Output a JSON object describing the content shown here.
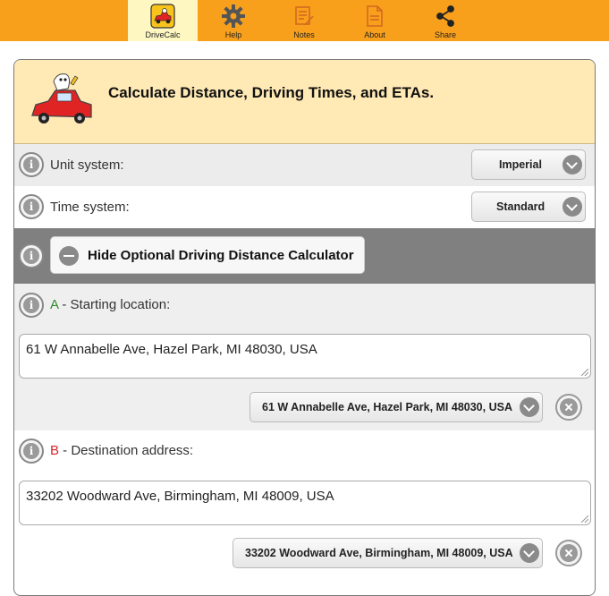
{
  "tabs": [
    {
      "label": "DriveCalc",
      "icon": "car-app-icon",
      "active": true
    },
    {
      "label": "Help",
      "icon": "gear-icon"
    },
    {
      "label": "Notes",
      "icon": "notepad-pencil-icon"
    },
    {
      "label": "About",
      "icon": "document-icon"
    },
    {
      "label": "Share",
      "icon": "share-icon"
    }
  ],
  "hero": {
    "title": "Calculate Distance, Driving Times, and ETAs."
  },
  "unit_system": {
    "label": "Unit system:",
    "selected": "Imperial"
  },
  "time_system": {
    "label": "Time system:",
    "selected": "Standard"
  },
  "toggle": {
    "label": "Hide Optional Driving Distance Calculator"
  },
  "start": {
    "letter": "A",
    "label": " - Starting location:",
    "value": "61 W Annabelle Ave, Hazel Park, MI 48030, USA",
    "selected": "61 W Annabelle Ave, Hazel Park, MI 48030, USA"
  },
  "dest": {
    "letter": "B",
    "label": " - Destination address:",
    "value": "33202 Woodward Ave, Birmingham, MI 48009, USA",
    "selected": "33202 Woodward Ave, Birmingham, MI 48009, USA"
  },
  "colors": {
    "topbar": "#f8a01c",
    "active_tab": "#fff7c2",
    "hero_bg": "#ffe9b5",
    "letter_a": "#2e8b2e",
    "letter_b": "#d8262a"
  }
}
